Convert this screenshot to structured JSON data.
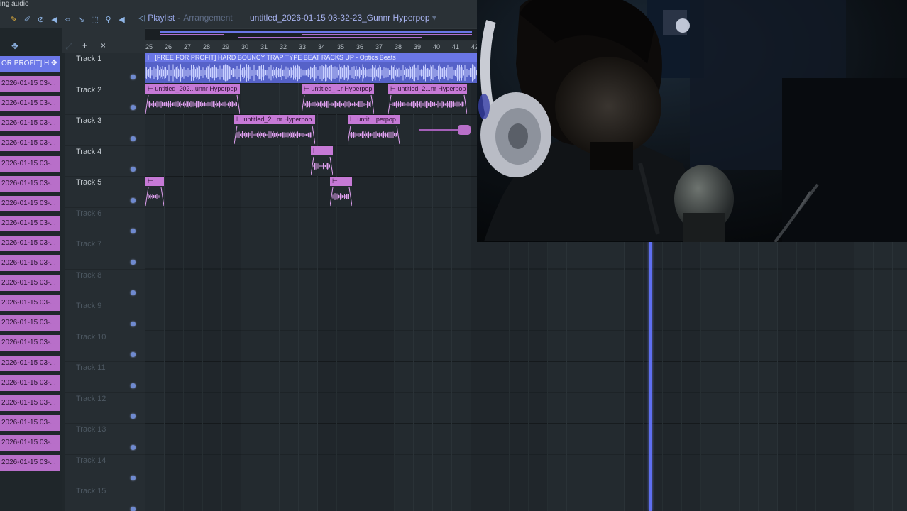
{
  "app": {
    "status_text": "ing audio",
    "playlist_label": "Playlist",
    "separator": "-",
    "view_label": "Arrangement",
    "project_name": "untitled_2026-01-15 03-32-23_Gunnr Hyperpop"
  },
  "toolbar": {
    "icons": [
      "pencil-icon",
      "paint-brush-icon",
      "delete-icon",
      "mute-icon",
      "slip-icon",
      "slice-icon",
      "select-icon",
      "zoom-icon",
      "playback-icon"
    ]
  },
  "ruler": {
    "bars": [
      "25",
      "26",
      "27",
      "28",
      "29",
      "30",
      "31",
      "32",
      "33",
      "34",
      "35",
      "36",
      "37",
      "38",
      "39",
      "40",
      "41",
      "42"
    ]
  },
  "picker": {
    "header_add": "+",
    "header_close": "×",
    "items": [
      "OR PROFIT] H...",
      "2026-01-15 03-...",
      "2026-01-15 03-...",
      "2026-01-15 03-...",
      "2026-01-15 03-...",
      "2026-01-15 03-...",
      "2026-01-15 03-...",
      "2026-01-15 03-...",
      "2026-01-15 03-...",
      "2026-01-15 03-...",
      "2026-01-15 03-...",
      "2026-01-15 03-...",
      "2026-01-15 03-...",
      "2026-01-15 03-...",
      "2026-01-15 03-...",
      "2026-01-15 03-...",
      "2026-01-15 03-...",
      "2026-01-15 03-...",
      "2026-01-15 03-...",
      "2026-01-15 03-...",
      "2026-01-15 03-..."
    ]
  },
  "tracks": [
    {
      "name": "Track 1",
      "active": true
    },
    {
      "name": "Track 2",
      "active": true
    },
    {
      "name": "Track 3",
      "active": true
    },
    {
      "name": "Track 4",
      "active": true
    },
    {
      "name": "Track 5",
      "active": true
    },
    {
      "name": "Track 6",
      "active": false
    },
    {
      "name": "Track 7",
      "active": false
    },
    {
      "name": "Track 8",
      "active": false
    },
    {
      "name": "Track 9",
      "active": false
    },
    {
      "name": "Track 10",
      "active": false
    },
    {
      "name": "Track 11",
      "active": false
    },
    {
      "name": "Track 12",
      "active": false
    },
    {
      "name": "Track 13",
      "active": false
    },
    {
      "name": "Track 14",
      "active": false
    },
    {
      "name": "Track 15",
      "active": false
    }
  ],
  "clips": {
    "main_beat": "⊢ [FREE FOR PROFIT] HARD BOUNCY TRAP TYPE BEAT RACKS UP - Optics Beats",
    "t2a": "⊢ untitled_202...unnr Hyperpop",
    "t2b": "⊢ untitled_...r Hyperpop",
    "t2c": "⊢ untitled_2...nr Hyperpop",
    "t3a": "⊢ untitled_2...nr Hyperpop",
    "t3b": "⊢ untitl...perpop",
    "t4a": "⊢",
    "t5a": "⊢",
    "t5b": "⊢"
  },
  "colors": {
    "audio_clip": "#c679d6",
    "main_clip": "#6a76e6",
    "playhead": "#5f6ff0"
  },
  "webcam": {
    "description_icon": "webcam-feed"
  }
}
